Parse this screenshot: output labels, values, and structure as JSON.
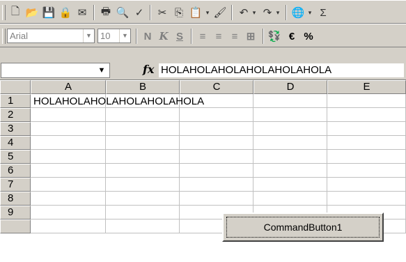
{
  "toolbar": {
    "standard_icons": [
      "new-icon",
      "open-icon",
      "save-icon",
      "permission-icon",
      "email-icon",
      "print-icon",
      "print-preview-icon",
      "spelling-icon",
      "cut-icon",
      "copy-icon",
      "paste-icon",
      "format-painter-icon",
      "undo-icon",
      "redo-icon",
      "insert-hyperlink-icon",
      "autosum-icon"
    ],
    "font_name": "Arial",
    "font_size": "10",
    "bold_label": "N",
    "italic_label": "K",
    "underline_label": "S",
    "euro_label": "€",
    "percent_label": "%"
  },
  "formula_bar": {
    "name_box": "",
    "fx_label": "fx",
    "formula": "HOLAHOLAHOLAHOLAHOLAHOLA"
  },
  "sheet": {
    "columns": [
      "A",
      "B",
      "C",
      "D",
      "E"
    ],
    "rows": [
      "1",
      "2",
      "3",
      "4",
      "5",
      "6",
      "7",
      "8",
      "9"
    ],
    "cell_A1": "HOLAHOLAHOLAHOLAHOLAHOLA"
  },
  "command_button": {
    "label": "CommandButton1"
  }
}
